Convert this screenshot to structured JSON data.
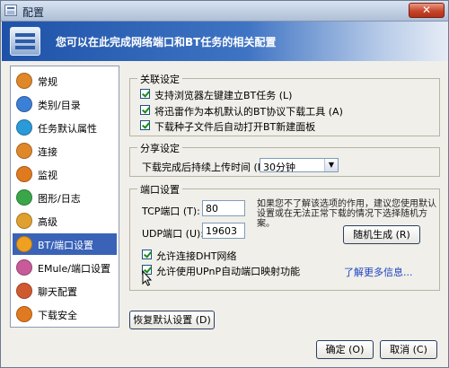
{
  "window": {
    "title": "配置",
    "close_glyph": "✕"
  },
  "banner": {
    "text": "您可以在此完成网络端口和BT任务的相关配置"
  },
  "sidebar": {
    "items": [
      {
        "label": "常规",
        "icon": "gear-icon",
        "color": "#e0872a"
      },
      {
        "label": "类别/目录",
        "icon": "folder-icon",
        "color": "#3b7fd6"
      },
      {
        "label": "任务默认属性",
        "icon": "task-properties-icon",
        "color": "#2a9ad8"
      },
      {
        "label": "连接",
        "icon": "connection-icon",
        "color": "#e0872a"
      },
      {
        "label": "监视",
        "icon": "monitor-icon",
        "color": "#e07a20"
      },
      {
        "label": "图形/日志",
        "icon": "graph-log-icon",
        "color": "#3aa64a"
      },
      {
        "label": "高级",
        "icon": "advanced-icon",
        "color": "#e0a030"
      },
      {
        "label": "BT/端口设置",
        "icon": "bt-icon",
        "color": "#f0a020"
      },
      {
        "label": "EMule/端口设置",
        "icon": "emule-icon",
        "color": "#c85a9a"
      },
      {
        "label": "聊天配置",
        "icon": "chat-icon",
        "color": "#d05a30"
      },
      {
        "label": "下载安全",
        "icon": "security-icon",
        "color": "#e07a20"
      }
    ],
    "selected_index": 7
  },
  "association": {
    "title": "关联设定",
    "options": [
      {
        "label": "支持浏览器左键建立BT任务 (L)",
        "checked": true
      },
      {
        "label": "将迅雷作为本机默认的BT协议下载工具 (A)",
        "checked": true
      },
      {
        "label": "下载种子文件后自动打开BT新建面板",
        "checked": true
      }
    ]
  },
  "share": {
    "title": "分享设定",
    "label": "下载完成后持续上传时间 (P):",
    "value": "30分钟"
  },
  "port": {
    "title": "端口设置",
    "tcp_label": "TCP端口 (T):",
    "tcp_value": "80",
    "udp_label": "UDP端口 (U):",
    "udp_value": "19603",
    "hint": "如果您不了解该选项的作用，建议您使用默认设置或在无法正常下载的情况下选择随机方案。",
    "random_button": "随机生成 (R)",
    "dht_label": "允许连接DHT网络",
    "dht_checked": true,
    "upnp_label": "允许使用UPnP自动端口映射功能",
    "upnp_checked": true,
    "learn_more": "了解更多信息..."
  },
  "buttons": {
    "restore": "恢复默认设置 (D)",
    "ok": "确定 (O)",
    "cancel": "取消 (C)"
  }
}
